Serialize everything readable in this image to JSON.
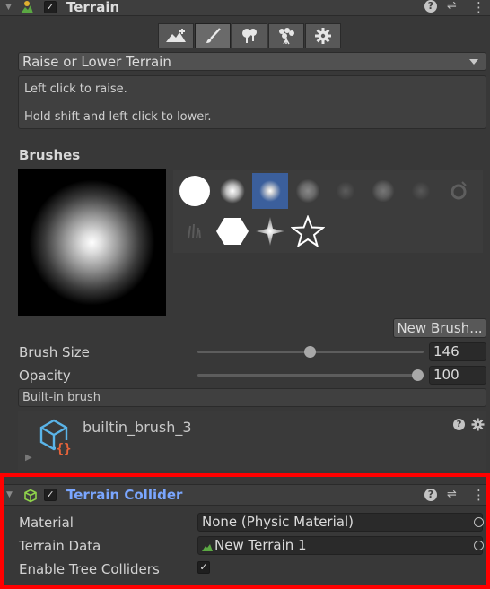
{
  "header": {
    "title": "Terrain",
    "help_glyph": "?",
    "settings_glyph": "⇌",
    "more_glyph": "⋮"
  },
  "toolbar": {
    "tools": [
      {
        "icon": "raise-terrain-icon",
        "active": false
      },
      {
        "icon": "paint-brush-icon",
        "active": true
      },
      {
        "icon": "paint-trees-icon",
        "active": false
      },
      {
        "icon": "paint-details-icon",
        "active": false
      },
      {
        "icon": "terrain-settings-icon",
        "active": false
      }
    ]
  },
  "mode_dropdown": {
    "value": "Raise or Lower Terrain"
  },
  "help": {
    "line1": "Left click to raise.",
    "line2": "Hold shift and left click to lower."
  },
  "brushes": {
    "heading": "Brushes",
    "new_brush_label": "New Brush...",
    "selected_index": 2
  },
  "brush_size": {
    "label": "Brush Size",
    "value": "146",
    "slider_fraction": 0.5
  },
  "opacity": {
    "label": "Opacity",
    "value": "100",
    "slider_fraction": 1.0
  },
  "builtin_label": "Built-in brush",
  "brush_asset": {
    "name": "builtin_brush_3",
    "icon": "brush-asset-icon"
  },
  "collider": {
    "title": "Terrain Collider",
    "material_label": "Material",
    "material_value": "None (Physic Material)",
    "terrain_data_label": "Terrain Data",
    "terrain_data_value": "New Terrain 1",
    "tree_colliders_label": "Enable Tree Colliders",
    "tree_colliders_checked": true,
    "title_color": "#7aa6ff",
    "highlight_color": "#ff0000"
  }
}
